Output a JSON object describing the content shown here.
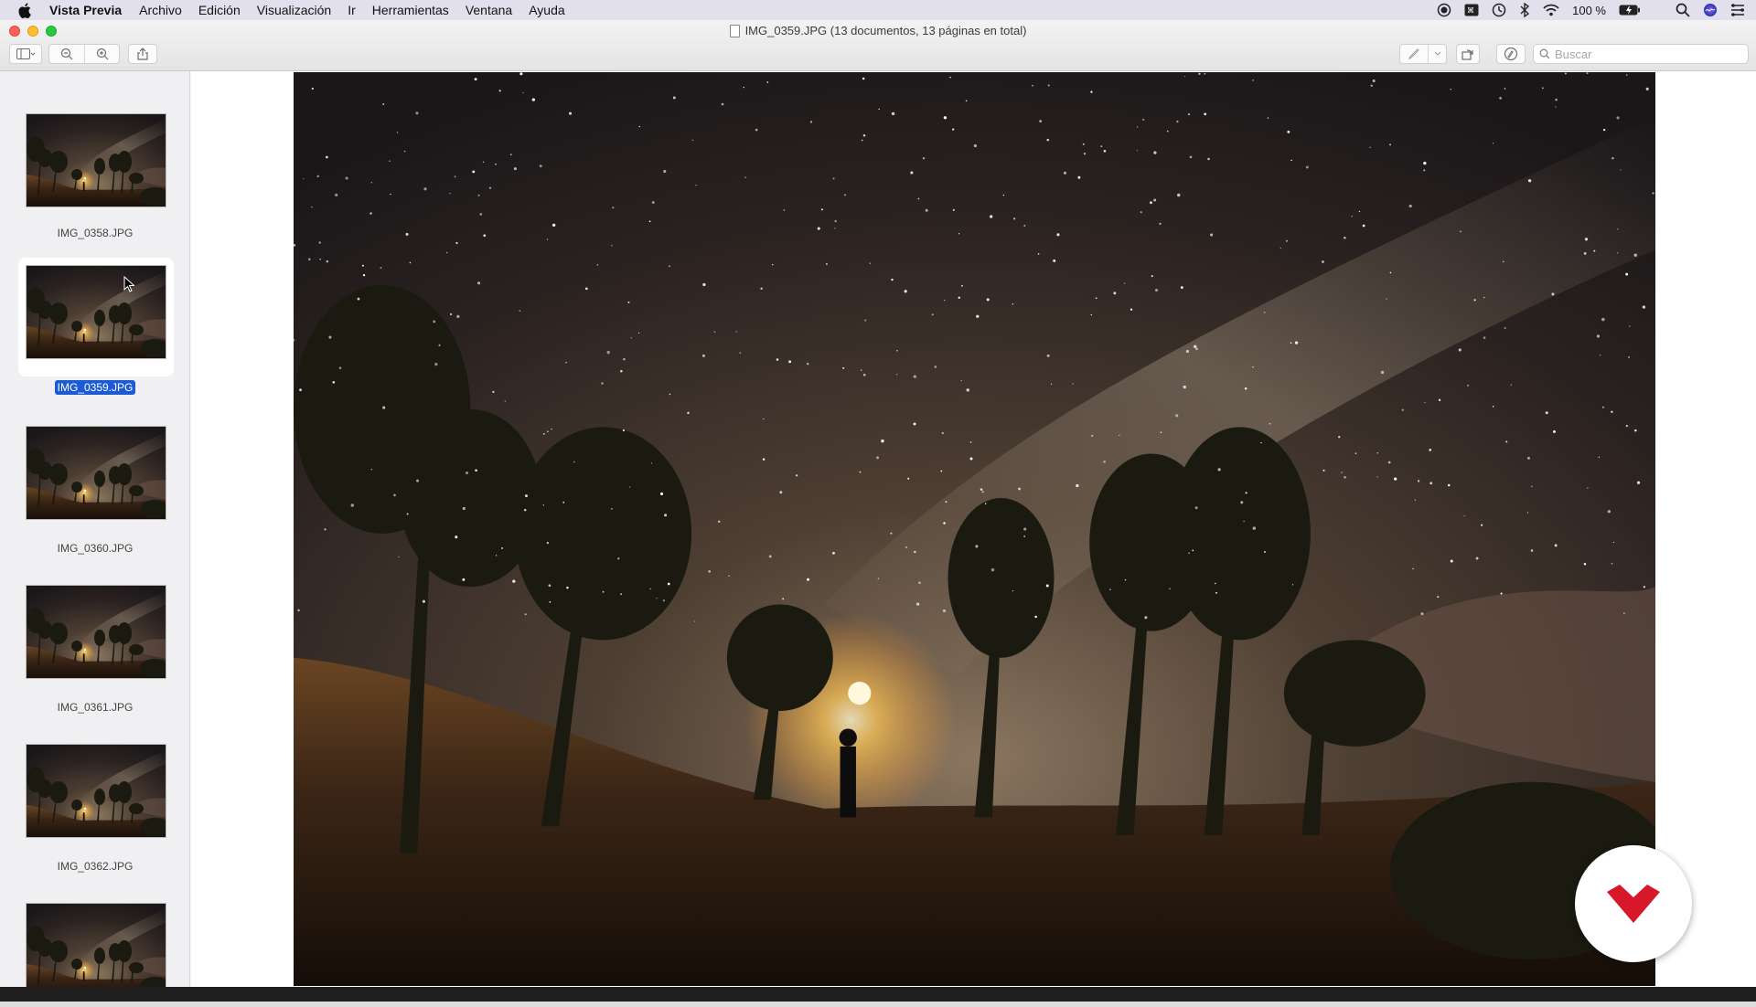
{
  "menubar": {
    "app_name": "Vista Previa",
    "items": [
      "Archivo",
      "Edición",
      "Visualización",
      "Ir",
      "Herramientas",
      "Ventana",
      "Ayuda"
    ],
    "battery": "100 %",
    "icons": [
      "record-icon",
      "screen-icon",
      "time-machine-icon",
      "bluetooth-icon",
      "wifi-icon",
      "battery-icon",
      "spotlight-icon",
      "siri-icon",
      "control-center-icon"
    ]
  },
  "window": {
    "title": "IMG_0359.JPG (13 documentos, 13 páginas en total)",
    "search_placeholder": "Buscar"
  },
  "sidebar": {
    "items": [
      {
        "label": "IMG_0358.JPG",
        "selected": false
      },
      {
        "label": "IMG_0359.JPG",
        "selected": true
      },
      {
        "label": "IMG_0360.JPG",
        "selected": false
      },
      {
        "label": "IMG_0361.JPG",
        "selected": false
      },
      {
        "label": "IMG_0362.JPG",
        "selected": false
      }
    ]
  },
  "colors": {
    "selection": "#1c5bd3",
    "logo_red": "#d7182a"
  }
}
